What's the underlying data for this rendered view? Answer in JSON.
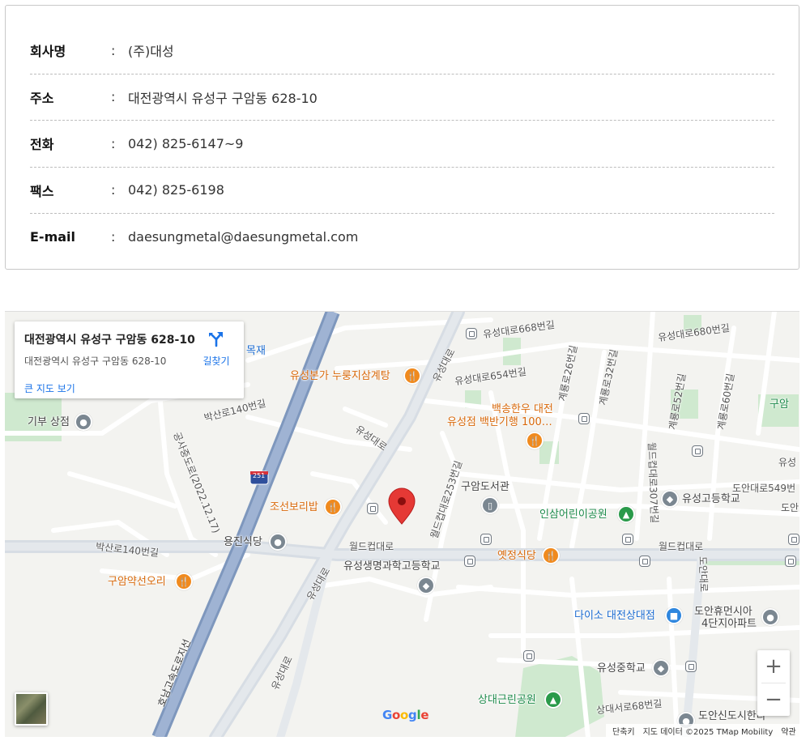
{
  "company_info": {
    "rows": [
      {
        "label": "회사명",
        "colon": ":",
        "value": "(주)대성"
      },
      {
        "label": "주소",
        "colon": ":",
        "value": "대전광역시 유성구 구암동 628-10"
      },
      {
        "label": "전화",
        "colon": ":",
        "value": "042) 825-6147~9"
      },
      {
        "label": "팩스",
        "colon": ":",
        "value": "042) 825-6198"
      },
      {
        "label": "E-mail",
        "colon": ":",
        "value": "daesungmetal@daesungmetal.com"
      }
    ]
  },
  "map": {
    "place_card": {
      "title": "대전광역시 유성구 구암동 628-10",
      "address": "대전광역시 유성구 구암동 628-10",
      "larger_map_link": "큰 지도 보기",
      "directions_label": "길찾기"
    },
    "labels": {
      "road_yuseong668": "유성대로668번길",
      "road_yuseong680": "유성대로680번길",
      "road_yuseong654": "유성대로654번길",
      "road_yuseongdaero_a": "유성대로",
      "road_yuseongdaero_b": "유성대로",
      "road_yuseongdaero_c": "유성대로",
      "road_yuseongdaero_d": "유성대로",
      "road_gyeryong26": "계룡로26번길",
      "road_gyeryong32": "계룡로32번길",
      "road_gyeryong52": "계룡로52번길",
      "road_gyeryong60": "계룡로60번길",
      "road_worldcup253": "월드컵대로253번길",
      "road_worldcup307": "월드컵대로307번길",
      "road_worldcup_a": "월드컵대로",
      "road_worldcup_b": "월드컵대로",
      "road_baksan140_a": "박산로140번길",
      "road_baksan140_b": "박산로140번길",
      "road_gongsa": "공사중도로(2022.12.17)",
      "road_doan549": "도안대로549번",
      "road_doan_right": "도안",
      "road_sangdae68": "상대서로68번길",
      "road_expressway": "호남고속도로지선",
      "road_yuseong_right": "유성",
      "shield_251": "251",
      "road_mokjae": "목재",
      "road_guam_right": "구암",
      "road_vertical_right": "도안대로",
      "poi_nurungji": "유성본가 누룽지삼계탕",
      "poi_baeksong_1": "백송한우 대전",
      "poi_baeksong_2": "유성점 백반기행 100…",
      "poi_gibu": "기부 상점",
      "poi_joseon": "조선보리밥",
      "poi_library": "구암도서관",
      "poi_insam_park": "인삼어린이공원",
      "poi_yuseong_high": "유성고등학교",
      "poi_yongjin": "용진식당",
      "poi_yetjeong": "옛정식당",
      "poi_life_science": "유성생명과학고등학교",
      "poi_guam_duck": "구암약선오리",
      "poi_daiso": "다이소 대전상대점",
      "poi_doan_rest": "도안휴먼시아",
      "poi_doan_rest2": "4단지아파트",
      "poi_yuseong_middle": "유성중학교",
      "poi_sangdae_park": "상대근린공원",
      "poi_doan_city": "도안신도시한라"
    },
    "zoom_in": "+",
    "zoom_out": "−",
    "google": [
      "G",
      "o",
      "o",
      "g",
      "l",
      "e"
    ],
    "attribution": {
      "shortcuts": "단축키",
      "map_data": "지도 데이터 ©2025 TMap Mobility",
      "terms": "약관"
    },
    "colors": {
      "marker": "#e53935",
      "highway": "#8aa2c4",
      "road": "#ffffff",
      "park": "#cfe9cf",
      "google_blue": "#4285F4",
      "google_red": "#EA4335",
      "google_yellow": "#FBBC05",
      "google_green": "#34A853"
    }
  }
}
